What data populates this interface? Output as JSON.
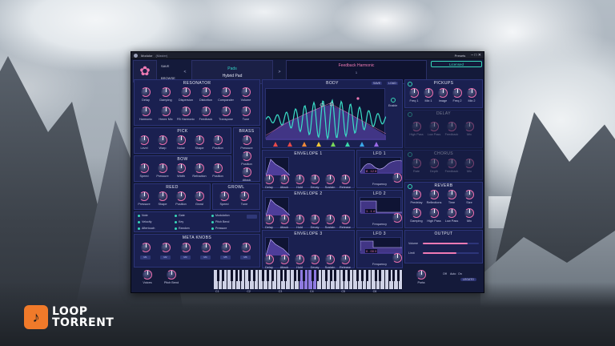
{
  "titlebar": {
    "app": "Modulor",
    "subtitle": "(Master)",
    "preset_menu": "Presets",
    "controls": "– □ ✕"
  },
  "header": {
    "save": "SAVE",
    "browse": "BROWSE",
    "category": "Pads",
    "preset_name": "Hybrid Pad",
    "display_title": "Feedback Harmonic",
    "display_num": "1",
    "license": "Licensed",
    "prev": "<",
    "next": ">"
  },
  "resonator": {
    "title": "RESONATOR",
    "row1": [
      "Delay",
      "Damping",
      "Dispersion",
      "Distortion",
      "Compander",
      "Volume"
    ],
    "row2": [
      "Harmonic",
      "Hmmr Mix",
      "FB Harmonic",
      "Feedback",
      "Transpose",
      "Tune"
    ]
  },
  "pick": {
    "title": "PICK",
    "knobs": [
      "Level",
      "Warp",
      "Noise",
      "Shape",
      "Position"
    ]
  },
  "brass": {
    "title": "BRASS",
    "knobs": [
      "Pressure",
      "Position",
      "Attack"
    ]
  },
  "bow": {
    "title": "BOW",
    "knobs": [
      "Speed",
      "Pressure",
      "Width",
      "Refraction",
      "Position"
    ]
  },
  "reed": {
    "title": "REED",
    "knobs": [
      "Pressure",
      "Shape",
      "Position",
      "Growl"
    ]
  },
  "growl": {
    "title": "GROWL",
    "knobs": [
      "Speed",
      "Tune"
    ]
  },
  "mod_sources": {
    "col1": [
      "Note",
      "Velocity",
      "Aftertouch"
    ],
    "col2": [
      "Gate",
      "Key",
      "Random"
    ],
    "col3": [
      "Modulation",
      "Pitch Bend",
      "Pressure"
    ]
  },
  "meta": {
    "title": "META KNOBS",
    "values": [
      "M1",
      "M2",
      "M3",
      "M4",
      "M5",
      "M6"
    ]
  },
  "bottom": {
    "voices": "Voices",
    "pitch_bend": "Pitch Bend",
    "porta": "Porta",
    "off": "Off",
    "auto": "Auto",
    "on": "On",
    "legato": "LEGATO",
    "octaves": [
      "C1",
      "C2",
      "C3",
      "C4",
      "C5",
      "C6"
    ]
  },
  "body": {
    "title": "BODY",
    "save": "SAVE",
    "load": "LOAD",
    "enable": "Enable",
    "axis": [
      "10",
      "",
      "",
      "20",
      "",
      "",
      "30",
      "",
      "",
      "40"
    ]
  },
  "envelopes": [
    {
      "title": "ENVELOPE 1",
      "knobs": [
        "Delay",
        "Attack",
        "Hold",
        "Decay",
        "Sustain",
        "Release"
      ]
    },
    {
      "title": "ENVELOPE 2",
      "knobs": [
        "Delay",
        "Attack",
        "Hold",
        "Decay",
        "Sustain",
        "Release"
      ]
    },
    {
      "title": "ENVELOPE 3",
      "knobs": [
        "Delay",
        "Attack",
        "Hold",
        "Decay",
        "Sustain",
        "Release"
      ]
    }
  ],
  "lfos": [
    {
      "title": "LFO 1",
      "knob": "Frequency",
      "seg": "8 . 12 8"
    },
    {
      "title": "LFO 2",
      "knob": "Frequency",
      "seg": "1 . 1 4"
    },
    {
      "title": "LFO 3",
      "knob": "Frequency",
      "seg": "0 . 00 0"
    }
  ],
  "pickups": {
    "title": "PICKUPS",
    "knobs": [
      "Freq 1",
      "Mix 1",
      "Image",
      "Freq 2",
      "Mix 2"
    ]
  },
  "delay": {
    "title": "DELAY",
    "knobs": [
      "High Pass",
      "Low Pass",
      "Feedback",
      "Mix"
    ]
  },
  "chorus": {
    "title": "CHORUS",
    "knobs": [
      "Rate",
      "Depth",
      "Feedback",
      "Mix"
    ]
  },
  "reverb": {
    "title": "REVERB",
    "row1": [
      "Predelay",
      "Reflections",
      "Time",
      "Size"
    ],
    "row2": [
      "Damping",
      "High Pass",
      "Low Pass",
      "Mix"
    ]
  },
  "output": {
    "title": "OUTPUT",
    "volume": "Volume",
    "limit": "Limit",
    "volume_level": 0.8,
    "limit_level": 0.6
  },
  "watermark": {
    "line1": "LOOP",
    "line2": "TORRENT"
  },
  "colors": {
    "accent_pink": "#f07ab4",
    "accent_teal": "#38d7b8",
    "panel": "#1a2050"
  }
}
